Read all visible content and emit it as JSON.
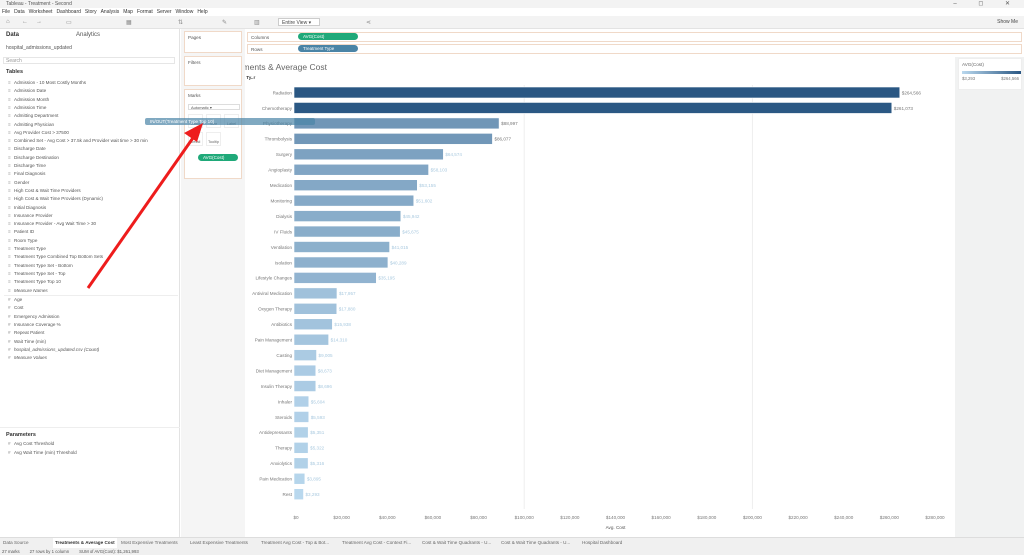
{
  "window": {
    "title": "Tableau - Treatment - Second",
    "controls": "– ◻ ✕"
  },
  "menu": [
    "File",
    "Data",
    "Worksheet",
    "Dashboard",
    "Story",
    "Analysis",
    "Map",
    "Format",
    "Server",
    "Window",
    "Help"
  ],
  "toolbar": {
    "view_select": "Entire View",
    "show_me": "Show Me"
  },
  "data_pane": {
    "tab_data": "Data",
    "tab_analytics": "Analytics",
    "datasource": "hospital_admissions_updated",
    "search_placeholder": "Search",
    "tables_header": "Tables",
    "dimensions": [
      "Admission - 10 Most Costly Months",
      "Admission Date",
      "Admission Month",
      "Admission Time",
      "Admitting Department",
      "Admitting Physician",
      "Avg Provider Cost > 37500",
      "Combined Set - Avg Cost > 37.5k and Provider wait time > 30 min",
      "Discharge Date",
      "Discharge Destination",
      "Discharge Time",
      "Final Diagnosis",
      "Gender",
      "High Cost & Wait Time Providers",
      "High Cost & Wait Time Providers (Dynamic)",
      "Initial Diagnosis",
      "Insurance Provider",
      "Insurance Provider - Avg Wait Time > 30",
      "Patient ID",
      "Room Type",
      "Treatment Type",
      "Treatment Type Combined Top Bottom Sets",
      "Treatment Type Set - Bottom",
      "Treatment Type Set - Top",
      "Treatment Type Top 10",
      "Measure Names"
    ],
    "measures": [
      "Age",
      "Cost",
      "Emergency Admission",
      "Insurance Coverage %",
      "Repeat Patient",
      "Wait Time (min)",
      "hospital_admissions_updated.csv (Count)",
      "Measure Values"
    ],
    "parameters_header": "Parameters",
    "parameters": [
      "Avg Cost Threshold",
      "Avg Wait Time (min) Threshold"
    ]
  },
  "cards": {
    "pages": "Pages",
    "filters": "Filters",
    "marks": "Marks",
    "mark_type": "Automatic",
    "buttons": [
      "Color",
      "Size",
      "Label",
      "Detail",
      "Tooltip"
    ],
    "mark_pill": "AVG(Cost)",
    "drag_pill": "IN/OUT(Treatment Type Top 10)"
  },
  "shelves": {
    "columns_label": "Columns",
    "columns_pill": "AVG(Cost)",
    "rows_label": "Rows",
    "rows_pill": "Treatment Type"
  },
  "legend": {
    "title": "AVG(Cost)",
    "min": "$3,293",
    "max": "$264,566"
  },
  "colors": {
    "bar_low": "#b9d8ee",
    "bar_high": "#2a5783",
    "annotation_arrow": "#ee1c1c"
  },
  "chart_data": {
    "type": "bar",
    "orientation": "horizontal",
    "title": "Treatments & Average Cost",
    "row_header": "Treatment Ty..r",
    "xlabel": "Avg. Cost",
    "xlim": [
      0,
      280000
    ],
    "x_ticks": [
      "$0",
      "$20,000",
      "$40,000",
      "$60,000",
      "$80,000",
      "$100,000",
      "$120,000",
      "$140,000",
      "$160,000",
      "$180,000",
      "$200,000",
      "$220,000",
      "$240,000",
      "$260,000",
      "$280,000"
    ],
    "categories": [
      "Radiation",
      "Chemotherapy",
      "Physiotherapy",
      "Thrombolysis",
      "Surgery",
      "Angioplasty",
      "Medication",
      "Monitoring",
      "Dialysis",
      "IV Fluids",
      "Ventilation",
      "Isolation",
      "Lifestyle Changes",
      "Antiviral Medication",
      "Oxygen Therapy",
      "Antibiotics",
      "Pain Management",
      "Casting",
      "Diet Management",
      "Insulin Therapy",
      "Inhaler",
      "Steroids",
      "Antidepressants",
      "Therapy",
      "Anxiolytics",
      "Pain Medication",
      "Rest"
    ],
    "values": [
      264566,
      261073,
      88997,
      86077,
      64574,
      58103,
      53155,
      51602,
      45942,
      45675,
      41015,
      40289,
      35195,
      17957,
      17880,
      15938,
      14310,
      9005,
      8673,
      8696,
      5604,
      5593,
      5351,
      5322,
      5316,
      3895,
      3293
    ],
    "labels": [
      "$264,566",
      "$261,073",
      "$88,997",
      "$86,077",
      "$64,574",
      "$58,103",
      "$53,155",
      "$51,602",
      "$45,942",
      "$45,675",
      "$41,015",
      "$40,289",
      "$35,195",
      "$17,957",
      "$17,880",
      "$15,938",
      "$14,310",
      "$9,005",
      "$8,673",
      "$8,696",
      "$5,604",
      "$5,593",
      "$5,351",
      "$5,322",
      "$5,316",
      "$3,895",
      "$3,293"
    ]
  },
  "sheet_tabs": {
    "data_source": "Data Source",
    "tabs": [
      "Treatments & Average Cost",
      "Most Expensive Treatments",
      "Least Expensive Treatments",
      "Treatment Avg Cost - Top & Bot...",
      "Treatment Avg Cost - Context Fi...",
      "Cost & Wait Time Quadrants - U...",
      "Cost & Wait Time Quadrants - U...",
      "Hospital Dashboard"
    ]
  },
  "status": {
    "marks": "27 marks",
    "rows": "27 rows by 1 column",
    "sum": "SUM of AVG(Cost): $1,261,993"
  }
}
